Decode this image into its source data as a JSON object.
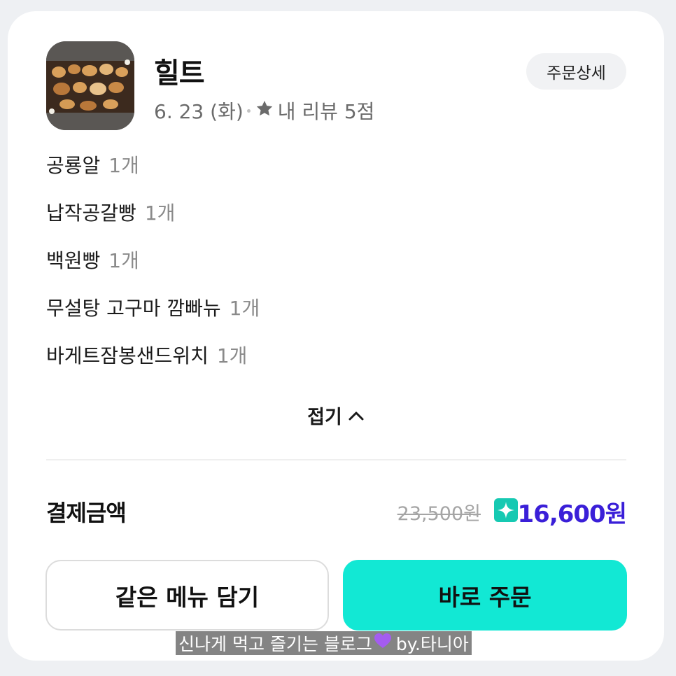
{
  "store": {
    "name": "힐트",
    "date": "6. 23 (화)",
    "review": "내 리뷰 5점",
    "detail_button": "주문상세"
  },
  "items": [
    {
      "name": "공룡알",
      "qty": "1개"
    },
    {
      "name": "납작공갈빵",
      "qty": "1개"
    },
    {
      "name": "백원빵",
      "qty": "1개"
    },
    {
      "name": "무설탕 고구마 깜빠뉴",
      "qty": "1개"
    },
    {
      "name": "바게트잠봉샌드위치",
      "qty": "1개"
    }
  ],
  "fold_label": "접기",
  "payment": {
    "label": "결제금액",
    "original_price": "23,500원",
    "final_price": "16,600원"
  },
  "actions": {
    "add_same_menu": "같은 메뉴 담기",
    "order_now": "바로 주문"
  },
  "caption": {
    "text": "신나게 먹고 즐기는 블로그",
    "byline": "by.타니아"
  },
  "colors": {
    "accent_mint": "#12e8d4",
    "price_purple": "#3a1fd8",
    "badge_teal": "#16c9b2"
  },
  "icons": [
    "store-thumbnail",
    "star-icon",
    "chevron-up-icon",
    "sparkle-badge-icon",
    "heart-emoji"
  ]
}
